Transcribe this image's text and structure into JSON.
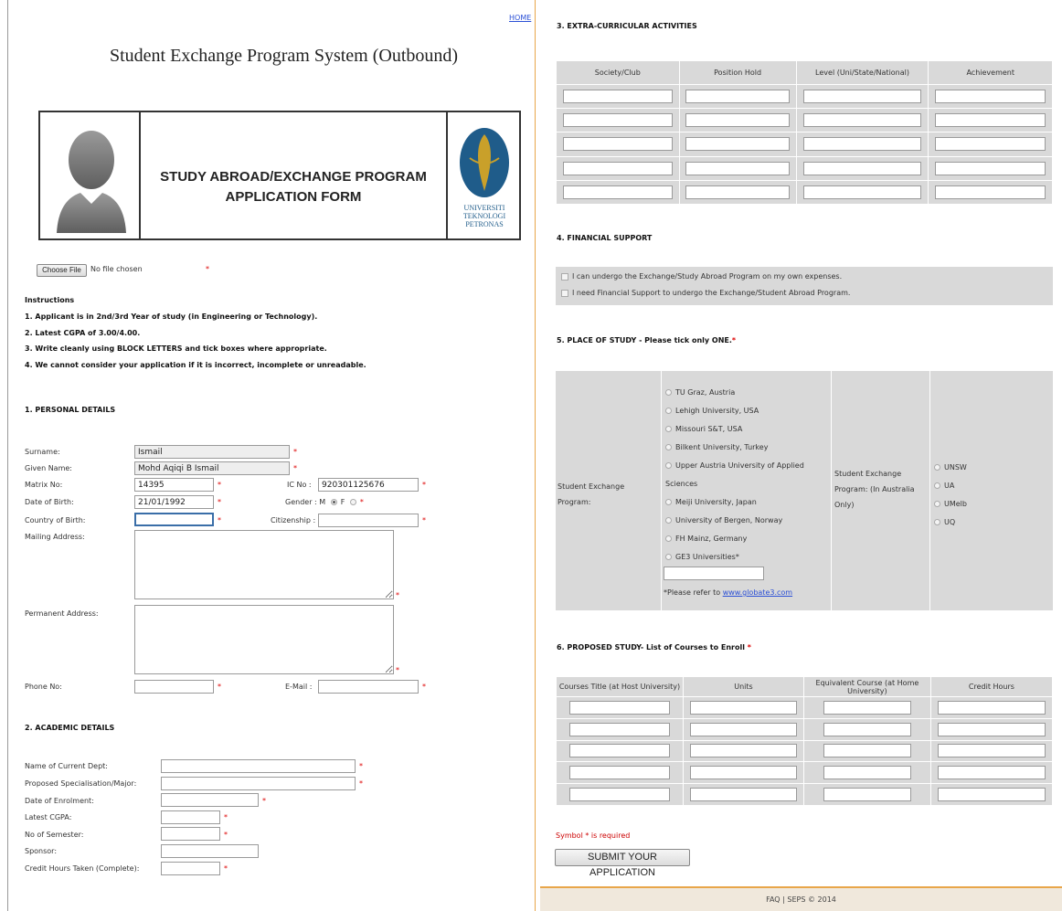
{
  "left": {
    "home_link": "HOME",
    "page_title": "Student Exchange Program System (Outbound)",
    "form_title_line1": "STUDY ABROAD/EXCHANGE PROGRAM",
    "form_title_line2": "APPLICATION FORM",
    "logo_text": [
      "UNIVERSITI",
      "TEKNOLOGI",
      "PETRONAS"
    ],
    "file_button": "Choose File",
    "file_status": "No file chosen",
    "instructions_title": "Instructions",
    "instructions": [
      "1. Applicant is in 2nd/3rd Year of study (in Engineering or Technology).",
      "2. Latest CGPA of 3.00/4.00.",
      "3. Write cleanly using BLOCK LETTERS and tick boxes where appropriate.",
      "4. We cannot consider your application if it is incorrect, incomplete or unreadable."
    ],
    "section1": "1. PERSONAL DETAILS",
    "section2": "2. ACADEMIC DETAILS",
    "personal": {
      "surname_label": "Surname:",
      "surname_value": "Ismail",
      "given_label": "Given Name:",
      "given_value": "Mohd Aqiqi B Ismail",
      "matrix_label": "Matrix No:",
      "matrix_value": "14395",
      "ic_label": "IC No :",
      "ic_value": "920301125676",
      "dob_label": "Date of Birth:",
      "dob_value": "21/01/1992",
      "gender_label": "Gender : M",
      "gender_f": "F",
      "cob_label": "Country of Birth:",
      "cob_value": "",
      "citizenship_label": "Citizenship :",
      "mailing_label": "Mailing Address:",
      "permanent_label": "Permanent Address:",
      "phone_label": "Phone No:",
      "email_label": "E-Mail :"
    },
    "academic": {
      "dept_label": "Name of Current Dept:",
      "spec_label": "Proposed Specialisation/Major:",
      "enrol_label": "Date of Enrolment:",
      "cgpa_label": "Latest CGPA:",
      "sem_label": "No of Semester:",
      "sponsor_label": "Sponsor:",
      "credit_label": "Credit Hours Taken (Complete):"
    },
    "required_mark": "*"
  },
  "right": {
    "section3": "3. EXTRA-CURRICULAR ACTIVITIES",
    "extra_headers": [
      "Society/Club",
      "Position Hold",
      "Level (Uni/State/National)",
      "Achievement"
    ],
    "section4": "4. FINANCIAL SUPPORT",
    "financial_options": [
      "I can undergo the Exchange/Study Abroad Program on my own expenses.",
      "I need Financial Support to undergo the Exchange/Student Abroad Program."
    ],
    "section5": "5. PLACE OF STUDY - Please tick only ONE.",
    "sep_label": "Student Exchange Program:",
    "sep_options": [
      "TU Graz, Austria",
      "Lehigh University, USA",
      "Missouri S&T, USA",
      "Bilkent University, Turkey",
      "Upper Austria University of Applied Sciences",
      "Meiji University, Japan",
      "University of Bergen, Norway",
      "FH Mainz, Germany",
      "GE3 Universities*"
    ],
    "refer_text": "*Please refer to",
    "refer_link": "www.globate3.com",
    "sep_aus_label": "Student Exchange Program: (In Australia Only)",
    "aus_options": [
      "UNSW",
      "UA",
      "UMelb",
      "UQ"
    ],
    "section6": "6. PROPOSED STUDY- List of Courses to Enroll",
    "course_headers": [
      "Courses Title (at Host University)",
      "Units",
      "Equivalent Course (at Home University)",
      "Credit Hours"
    ],
    "symbol_note": "Symbol * is required",
    "submit_label": "SUBMIT YOUR APPLICATION",
    "footer": "FAQ | SEPS © 2014"
  }
}
